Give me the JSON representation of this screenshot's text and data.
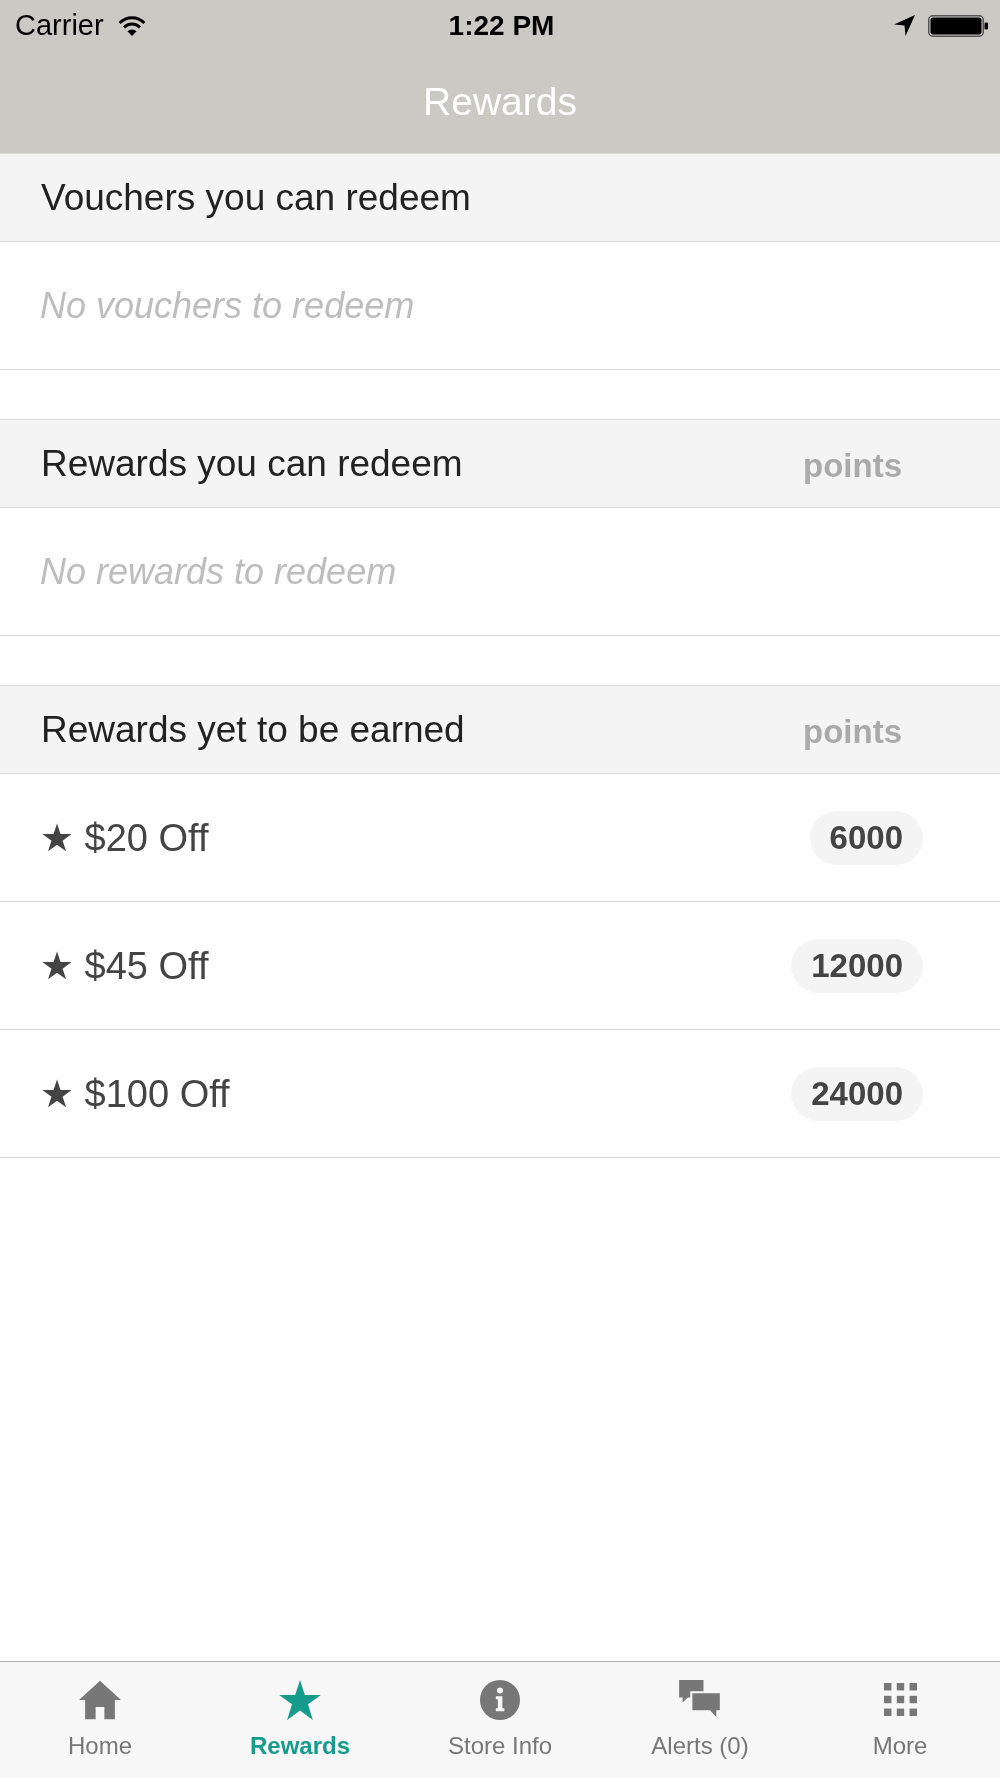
{
  "status_bar": {
    "carrier": "Carrier",
    "time": "1:22 PM"
  },
  "nav_bar": {
    "title": "Rewards"
  },
  "sections": [
    {
      "title": "Vouchers you can redeem",
      "empty_message": "No vouchers to redeem"
    },
    {
      "title": "Rewards you can redeem",
      "column_label": "points",
      "empty_message": "No rewards to redeem"
    },
    {
      "title": "Rewards yet to be earned",
      "column_label": "points",
      "items": [
        {
          "label": "★ $20 Off",
          "points": "6000"
        },
        {
          "label": "★ $45 Off",
          "points": "12000"
        },
        {
          "label": "★ $100 Off",
          "points": "24000"
        }
      ]
    }
  ],
  "tab_bar": {
    "tabs": [
      {
        "label": "Home",
        "selected": false
      },
      {
        "label": "Rewards",
        "selected": true
      },
      {
        "label": "Store Info",
        "selected": false
      },
      {
        "label": "Alerts (0)",
        "selected": false
      },
      {
        "label": "More",
        "selected": false
      }
    ]
  }
}
